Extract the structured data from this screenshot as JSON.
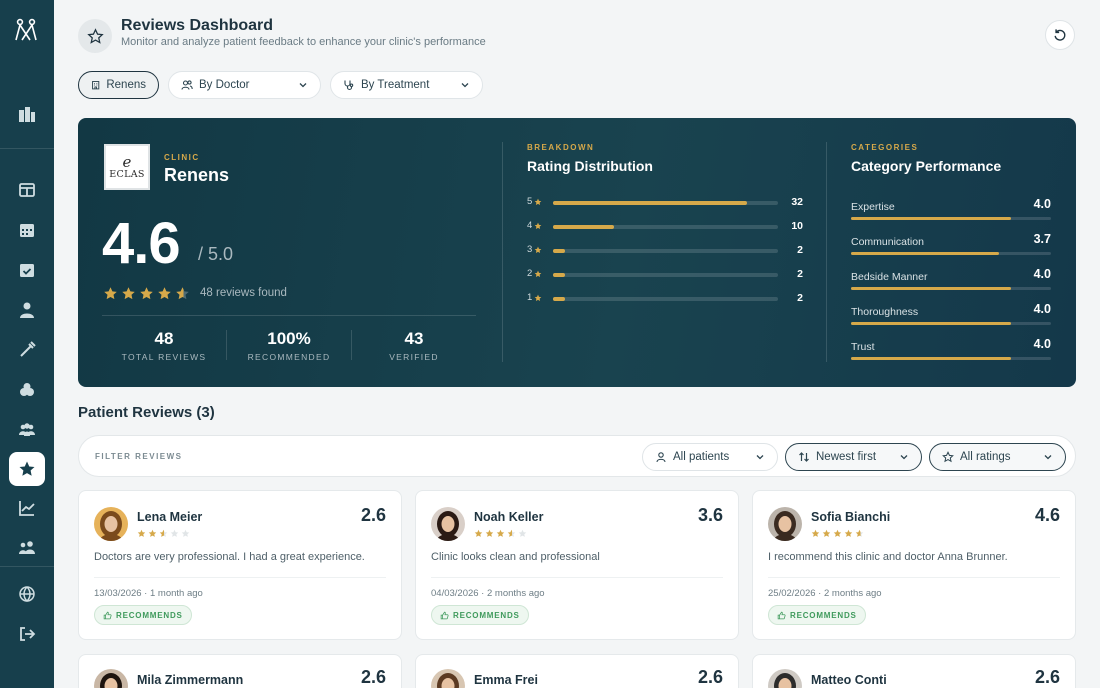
{
  "header": {
    "title": "Reviews Dashboard",
    "subtitle": "Monitor and analyze patient feedback to enhance your clinic's performance"
  },
  "filters": {
    "clinic": "Renens",
    "doctor": "By Doctor",
    "treatment": "By Treatment"
  },
  "hero": {
    "clinic_label": "CLINIC",
    "clinic_name": "Renens",
    "logo_mark": "e",
    "logo_text": "ECLAS",
    "score": "4.6",
    "score_max": "/ 5.0",
    "rating": 4.6,
    "reviews_found": "48 reviews found",
    "stats": [
      {
        "value": "48",
        "label": "TOTAL REVIEWS"
      },
      {
        "value": "100%",
        "label": "RECOMMENDED"
      },
      {
        "value": "43",
        "label": "VERIFIED"
      }
    ]
  },
  "breakdown": {
    "label": "BREAKDOWN",
    "title": "Rating Distribution",
    "rows": [
      {
        "stars": "5",
        "count": 32
      },
      {
        "stars": "4",
        "count": 10
      },
      {
        "stars": "3",
        "count": 2
      },
      {
        "stars": "2",
        "count": 2
      },
      {
        "stars": "1",
        "count": 2
      }
    ]
  },
  "categories": {
    "label": "CATEGORIES",
    "title": "Category Performance",
    "items": [
      {
        "name": "Expertise",
        "value": "4.0",
        "score": 4.0
      },
      {
        "name": "Communication",
        "value": "3.7",
        "score": 3.7
      },
      {
        "name": "Bedside Manner",
        "value": "4.0",
        "score": 4.0
      },
      {
        "name": "Thoroughness",
        "value": "4.0",
        "score": 4.0
      },
      {
        "name": "Trust",
        "value": "4.0",
        "score": 4.0
      }
    ]
  },
  "reviews_section": {
    "title": "Patient Reviews (3)",
    "filter_label": "FILTER REVIEWS",
    "patients_select": "All patients",
    "sort_select": "Newest first",
    "ratings_select": "All ratings"
  },
  "reviews": [
    {
      "name": "Lena Meier",
      "score": "2.6",
      "rating": 2.6,
      "text": "Doctors are very professional. I had a great experience.",
      "date": "13/03/2026",
      "ago": "1 month ago",
      "badge": "RECOMMENDS",
      "avatar_bg": "#e6b25a",
      "avatar_hair": "#7a4a1c"
    },
    {
      "name": "Noah Keller",
      "score": "3.6",
      "rating": 3.6,
      "text": "Clinic looks clean and professional",
      "date": "04/03/2026",
      "ago": "2 months ago",
      "badge": "RECOMMENDS",
      "avatar_bg": "#d9cfc8",
      "avatar_hair": "#2a1a14"
    },
    {
      "name": "Sofia Bianchi",
      "score": "4.6",
      "rating": 4.6,
      "text": "I recommend this clinic and doctor Anna Brunner.",
      "date": "25/02/2026",
      "ago": "2 months ago",
      "badge": "RECOMMENDS",
      "avatar_bg": "#bcb4ab",
      "avatar_hair": "#3a2a20"
    },
    {
      "name": "Mila Zimmermann",
      "score": "2.6",
      "rating": 2.6,
      "avatar_bg": "#c9b7a5",
      "avatar_hair": "#1e140e"
    },
    {
      "name": "Emma Frei",
      "score": "2.6",
      "rating": 2.6,
      "avatar_bg": "#d8c6b2",
      "avatar_hair": "#5c3a22"
    },
    {
      "name": "Matteo Conti",
      "score": "2.6",
      "rating": 2.6,
      "avatar_bg": "#cfcac4",
      "avatar_hair": "#2c2c2c"
    }
  ],
  "colors": {
    "sidebar": "#173f4c",
    "gold": "#d6a94a",
    "hero": "#19434f",
    "recommend_green": "#3f9a5c"
  },
  "icons": {
    "sidebar": [
      "logo-icon",
      "building-icon",
      "layout-icon",
      "calendar-icon",
      "calendar-check-icon",
      "doctor-icon",
      "syringe-icon",
      "pills-icon",
      "users-icon",
      "star-icon",
      "chart-icon",
      "team-icon",
      "globe-icon",
      "logout-icon"
    ]
  }
}
